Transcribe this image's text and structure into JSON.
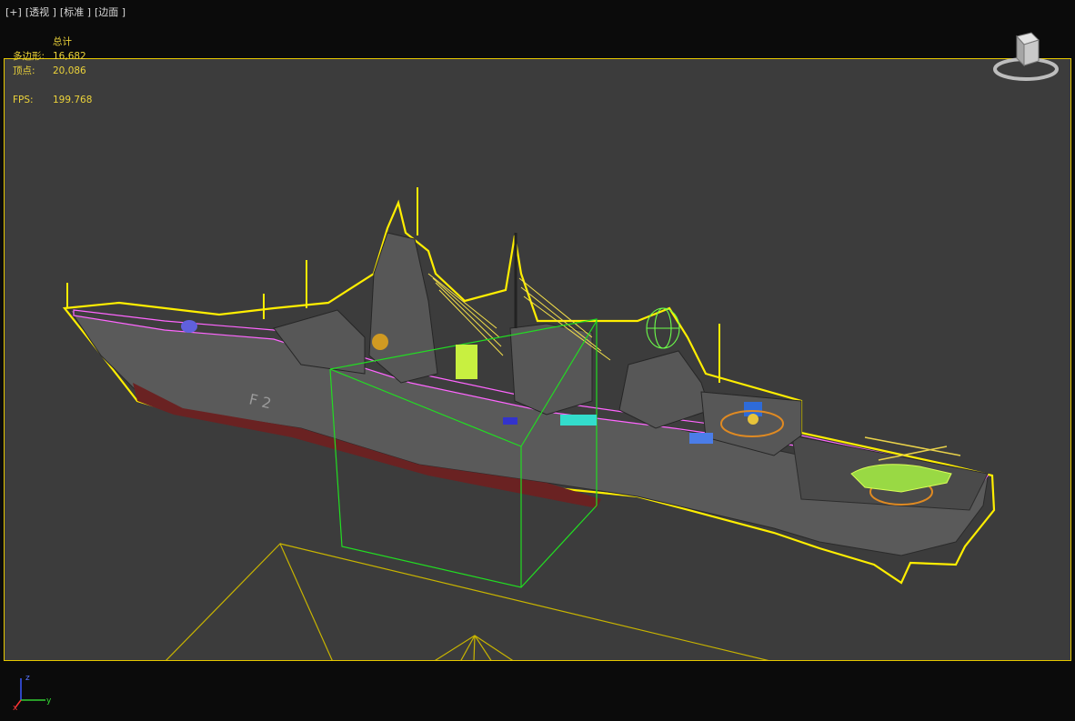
{
  "viewport": {
    "menus": [
      "[+]",
      "[透视 ]",
      "[标准 ]",
      "[边面 ]"
    ],
    "stats": {
      "header": "总计",
      "polygons_label": "多边形:",
      "polygons_value": "16,682",
      "vertices_label": "顶点:",
      "vertices_value": "20,086",
      "fps_label": "FPS:",
      "fps_value": "199.768"
    },
    "hull_marking": "F 2",
    "axis": {
      "x": "x",
      "y": "y",
      "z": "z"
    },
    "colors": {
      "active_border": "#e6c800",
      "stats_text": "#ecd33a",
      "grid_lines": "#c8b400",
      "selection_outline": "#ffee00",
      "bounding_box": "#22dd22",
      "hull": "#5a5a5a"
    }
  }
}
